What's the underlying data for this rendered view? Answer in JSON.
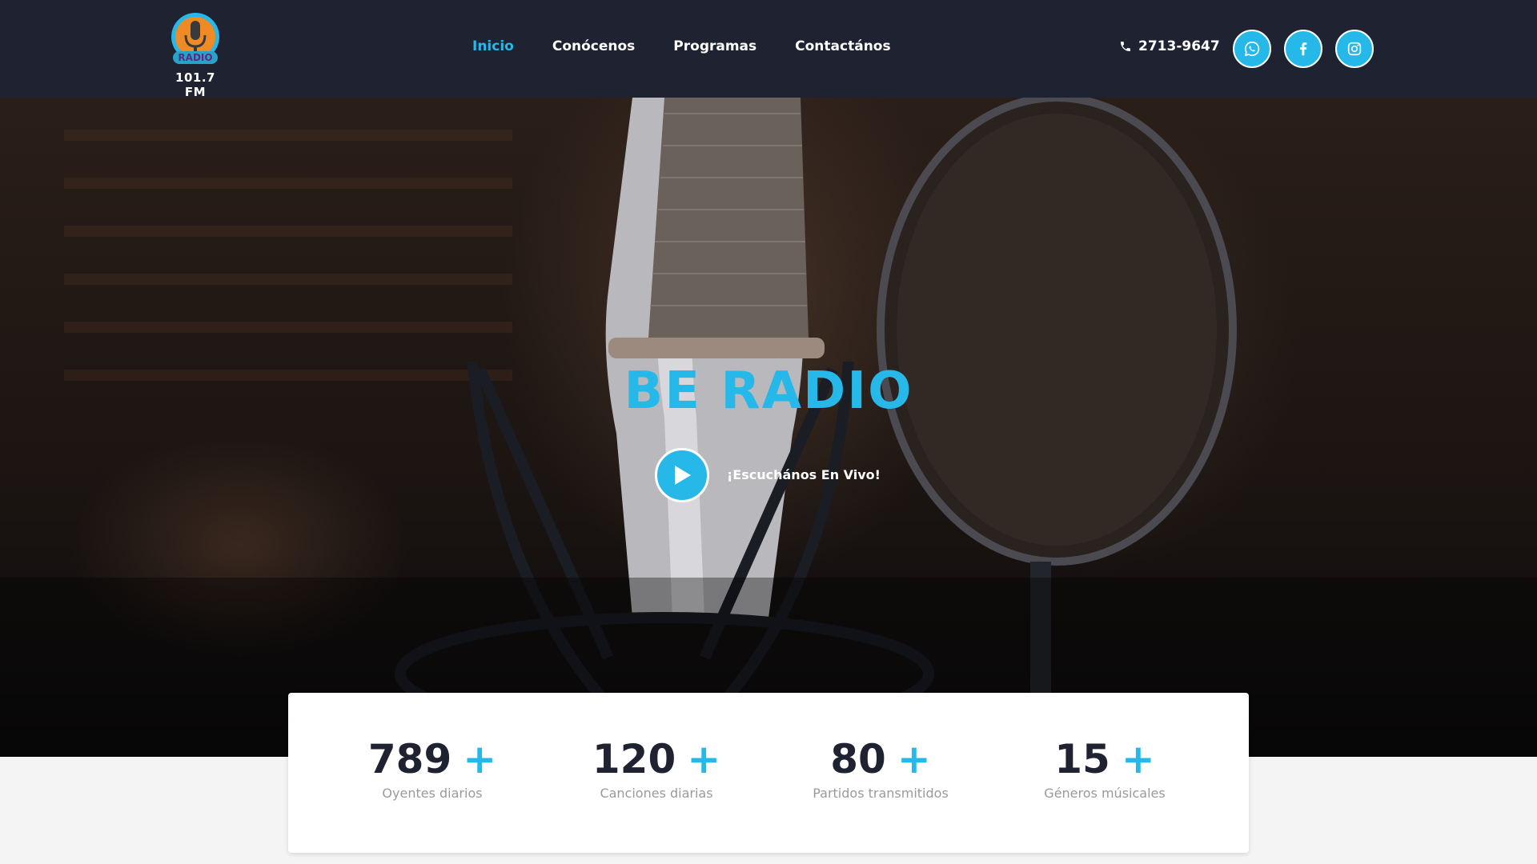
{
  "logo": {
    "badge_text": "RADIO",
    "frequency": "101.7 FM"
  },
  "nav": {
    "items": [
      {
        "label": "Inicio",
        "active": true
      },
      {
        "label": "Conócenos",
        "active": false
      },
      {
        "label": "Programas",
        "active": false
      },
      {
        "label": "Contactános",
        "active": false
      }
    ]
  },
  "contact": {
    "phone": "2713-9647",
    "phone_icon": "phone-icon"
  },
  "social": [
    "whatsapp-icon",
    "facebook-icon",
    "instagram-icon"
  ],
  "hero": {
    "title": "BE RADIO",
    "play_icon": "play-icon",
    "live_label": "¡Escuchános En Vivo!"
  },
  "stats": [
    {
      "value": "789",
      "plus": "+",
      "label": "Oyentes diarios"
    },
    {
      "value": "120",
      "plus": "+",
      "label": "Canciones diarias"
    },
    {
      "value": "80",
      "plus": "+",
      "label": "Partidos transmitidos"
    },
    {
      "value": "15",
      "plus": "+",
      "label": "Géneros músicales"
    }
  ],
  "colors": {
    "accent": "#26b8e8",
    "header_bg": "#1f2230",
    "text_dark": "#1f2230",
    "muted": "#9a9a9a"
  }
}
